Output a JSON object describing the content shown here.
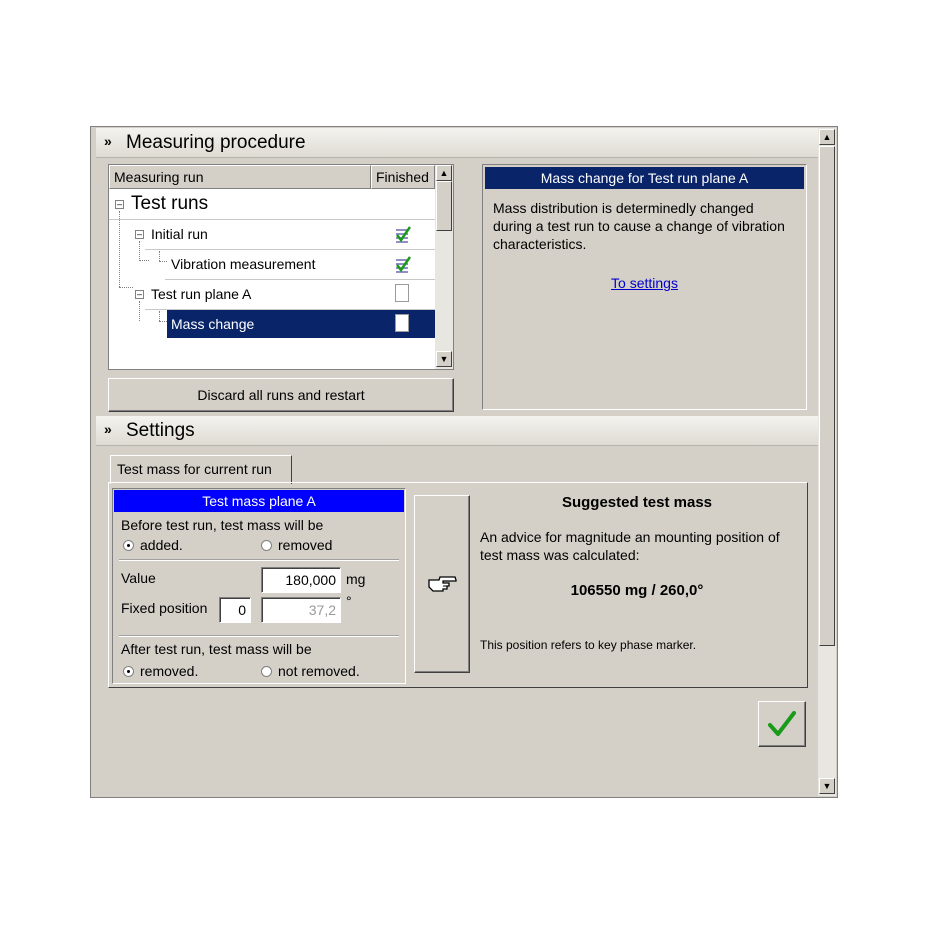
{
  "measuring_procedure": {
    "title": "Measuring procedure",
    "columns": {
      "run": "Measuring run",
      "finished": "Finished"
    },
    "tree": {
      "group": "Test runs",
      "items": [
        {
          "label": "Initial run",
          "status": "checked-icon"
        },
        {
          "label": "Vibration measurement",
          "status": "checked-icon"
        },
        {
          "label": "Test run plane A",
          "status": "document-icon"
        },
        {
          "label": "Mass change",
          "status": "document-icon",
          "selected": true
        }
      ]
    },
    "discard_button": "Discard all runs and restart",
    "info": {
      "header": "Mass change for Test run plane A",
      "text": "Mass distribution is determinedly changed during a test run to cause a change of vibration characteristics.",
      "link": "To settings"
    }
  },
  "settings": {
    "title": "Settings",
    "tab": "Test mass for current run",
    "plane_header": "Test mass plane A",
    "before_label": "Before test run, test mass will be",
    "before_options": [
      "added.",
      "removed"
    ],
    "before_selected": "added.",
    "value_label": "Value",
    "value": "180,000",
    "value_unit": "mg",
    "fixed_label": "Fixed position",
    "fixed_index": "0",
    "fixed_angle": "37,2",
    "fixed_unit": "°",
    "after_label": "After test run, test mass will be",
    "after_options": [
      "removed.",
      "not removed."
    ],
    "after_selected": "removed.",
    "suggested": {
      "title": "Suggested test mass",
      "text": "An advice for magnitude an mounting position of test mass was calculated:",
      "value": "106550 mg / 260,0°",
      "note": "This position refers to key phase marker."
    },
    "apply_icon": "pointing-hand-icon"
  },
  "confirm_icon": "checkmark-icon",
  "colors": {
    "selection": "#0a246a",
    "panel": "#d4d0c8",
    "check": "#1a9a1a"
  }
}
